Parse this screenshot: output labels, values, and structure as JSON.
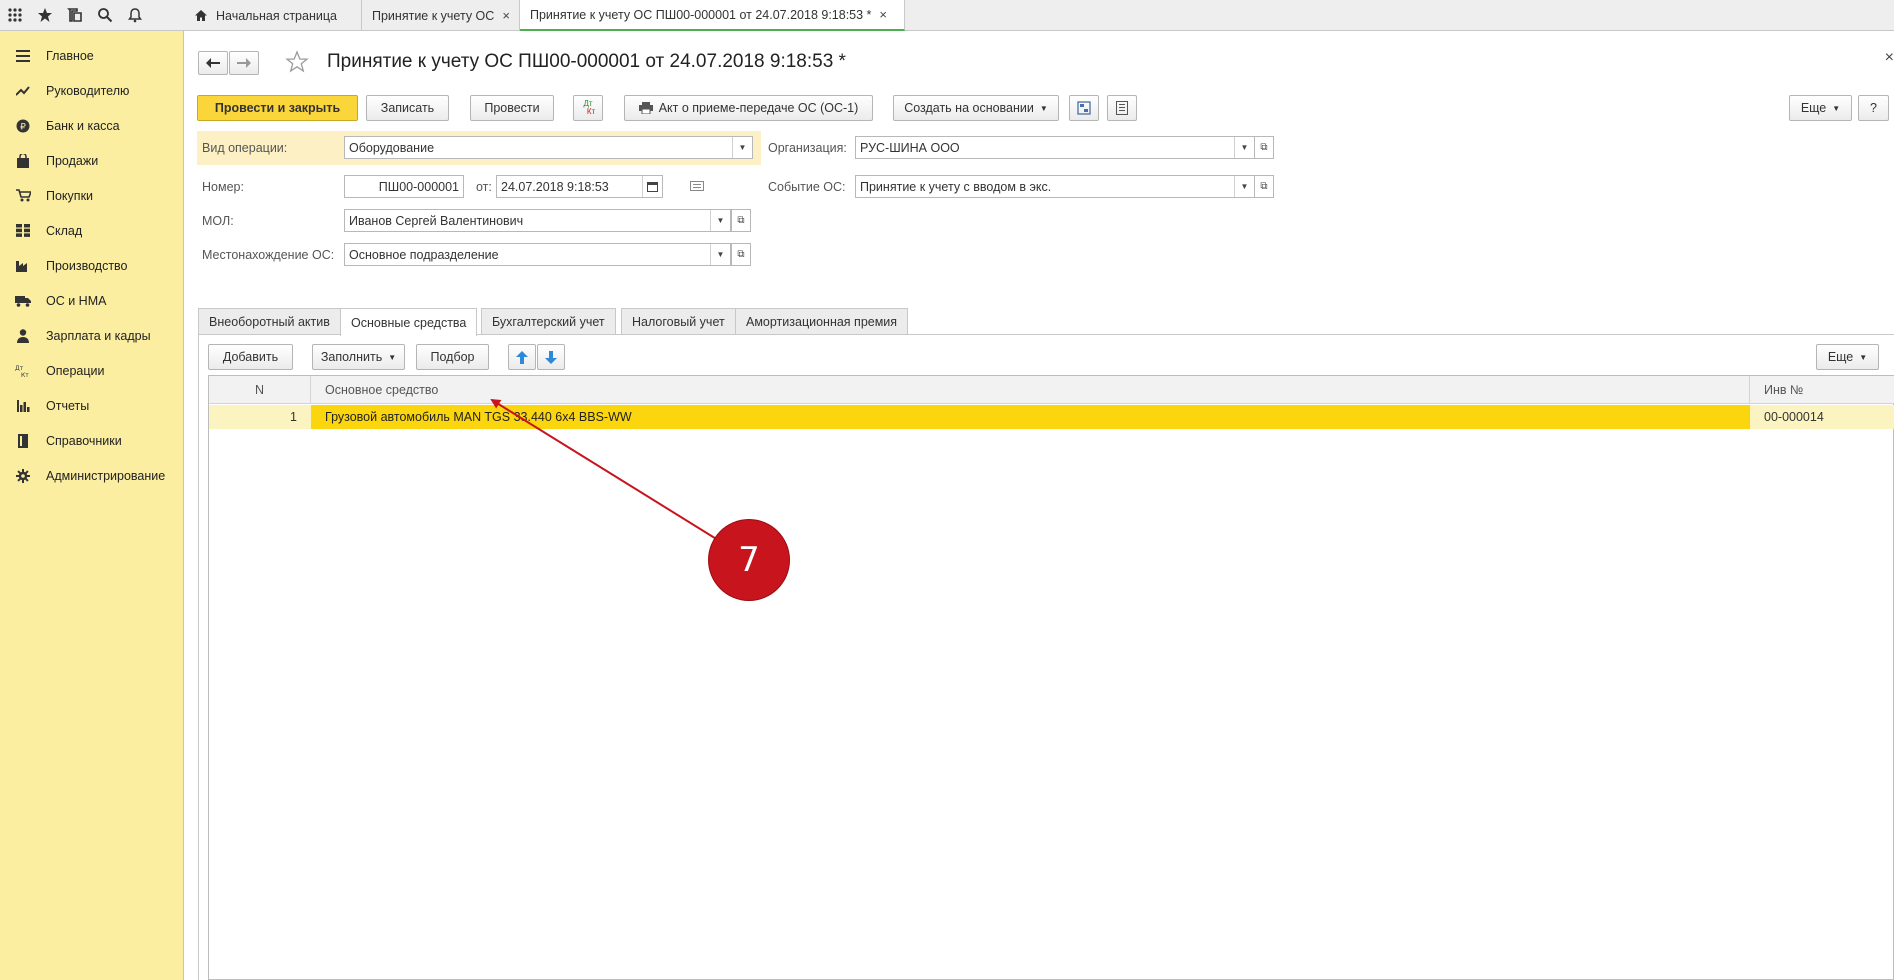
{
  "topbar": {
    "icons": [
      "apps-grid-icon",
      "star-icon",
      "history-icon",
      "search-icon",
      "bell-icon"
    ],
    "tabs": [
      {
        "label": "Начальная страница",
        "icon": "home-icon"
      },
      {
        "label": "Принятие к учету ОС",
        "close": "×"
      },
      {
        "label": "Принятие к учету ОС ПШ00-000001 от 24.07.2018 9:18:53 *",
        "close": "×",
        "active": true
      }
    ]
  },
  "sidebar": {
    "items": [
      {
        "label": "Главное",
        "icon": "menu-lines-icon"
      },
      {
        "label": "Руководителю",
        "icon": "trend-icon"
      },
      {
        "label": "Банк и касса",
        "icon": "ruble-coin-icon"
      },
      {
        "label": "Продажи",
        "icon": "bag-icon"
      },
      {
        "label": "Покупки",
        "icon": "cart-icon"
      },
      {
        "label": "Склад",
        "icon": "warehouse-grid-icon"
      },
      {
        "label": "Производство",
        "icon": "factory-icon"
      },
      {
        "label": "ОС и НМА",
        "icon": "truck-icon"
      },
      {
        "label": "Зарплата и кадры",
        "icon": "person-icon"
      },
      {
        "label": "Операции",
        "icon": "dt-kt-icon"
      },
      {
        "label": "Отчеты",
        "icon": "bar-chart-icon"
      },
      {
        "label": "Справочники",
        "icon": "book-icon"
      },
      {
        "label": "Администрирование",
        "icon": "gear-icon"
      }
    ]
  },
  "form": {
    "title": "Принятие к учету ОС ПШ00-000001 от 24.07.2018 9:18:53 *",
    "close": "×",
    "toolbar": {
      "post_close": "Провести и закрыть",
      "save": "Записать",
      "post": "Провести",
      "dt_kt_top": "Дт",
      "dt_kt_bottom": "Кт",
      "print_act": "Акт о приеме-передаче ОС (ОС-1)",
      "create_based": "Создать на основании",
      "more": "Еще",
      "help": "?"
    },
    "fields": {
      "op_type_label": "Вид операции:",
      "op_type_value": "Оборудование",
      "org_label": "Организация:",
      "org_value": "РУС-ШИНА ООО",
      "number_label": "Номер:",
      "number_value": "ПШ00-000001",
      "date_label": "от:",
      "date_value": "24.07.2018  9:18:53",
      "event_label": "Событие ОС:",
      "event_value": "Принятие к учету с вводом в экс.",
      "mol_label": "МОЛ:",
      "mol_value": "Иванов Сергей Валентинович",
      "location_label": "Местонахождение ОС:",
      "location_value": "Основное подразделение"
    },
    "tabs": [
      "Внеоборотный актив",
      "Основные средства",
      "Бухгалтерский учет",
      "Налоговый учет",
      "Амортизационная премия"
    ],
    "active_tab": 1,
    "table_toolbar": {
      "add": "Добавить",
      "fill": "Заполнить",
      "pick": "Подбор",
      "more": "Еще"
    },
    "table": {
      "columns": [
        "N",
        "Основное средство",
        "Инв №"
      ],
      "rows": [
        {
          "n": "1",
          "asset": "Грузовой автомобиль MAN TGS 33.440 6x4 BBS-WW",
          "inv": "00-000014"
        }
      ]
    }
  },
  "annotation": {
    "badge": "7",
    "color": "#c8141c"
  }
}
